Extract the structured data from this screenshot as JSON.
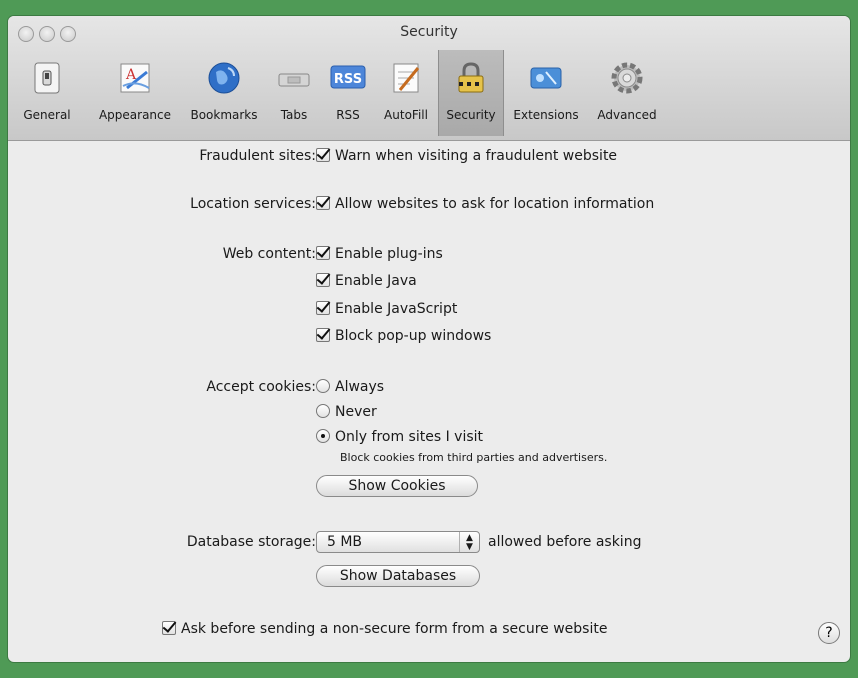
{
  "window": {
    "title": "Security"
  },
  "toolbar": {
    "items": [
      {
        "label": "General",
        "icon": "general-switch-icon"
      },
      {
        "label": "Appearance",
        "icon": "appearance-icon"
      },
      {
        "label": "Bookmarks",
        "icon": "bookmarks-globe-icon"
      },
      {
        "label": "Tabs",
        "icon": "tabs-icon"
      },
      {
        "label": "RSS",
        "icon": "rss-icon",
        "badge": "RSS"
      },
      {
        "label": "AutoFill",
        "icon": "autofill-icon"
      },
      {
        "label": "Security",
        "icon": "lock-icon",
        "selected": true
      },
      {
        "label": "Extensions",
        "icon": "extensions-icon"
      },
      {
        "label": "Advanced",
        "icon": "gear-icon"
      }
    ]
  },
  "security": {
    "fraudulent_label": "Fraudulent sites:",
    "fraudulent_option": "Warn when visiting a fraudulent website",
    "location_label": "Location services:",
    "location_option": "Allow websites to ask for location information",
    "web_content_label": "Web content:",
    "web_content_options": [
      "Enable plug-ins",
      "Enable Java",
      "Enable JavaScript",
      "Block pop-up windows"
    ],
    "cookies_label": "Accept cookies:",
    "cookies_options": [
      "Always",
      "Never",
      "Only from sites I visit"
    ],
    "cookies_selected": "Only from sites I visit",
    "cookies_note": "Block cookies from third parties and advertisers.",
    "show_cookies_button": "Show Cookies",
    "database_label": "Database storage:",
    "database_value": "5 MB",
    "database_suffix": "allowed before asking",
    "show_databases_button": "Show Databases",
    "nonsecure_form_option": "Ask before sending a non-secure form from a secure website",
    "help_button": "?"
  }
}
